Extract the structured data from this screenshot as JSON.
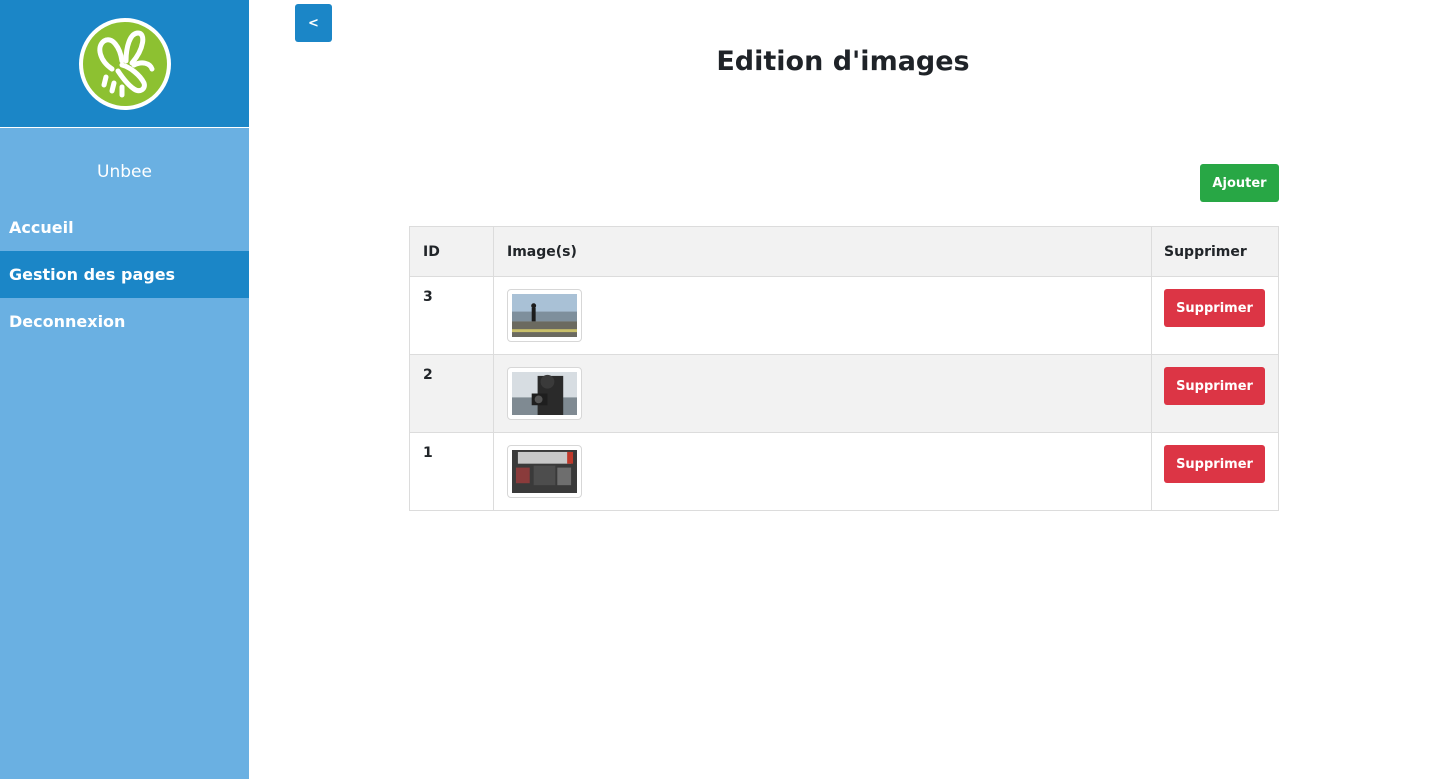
{
  "sidebar": {
    "logo_icon": "bee-logo-icon",
    "brand": "Unbee",
    "items": [
      {
        "label": "Accueil",
        "active": false
      },
      {
        "label": "Gestion des pages",
        "active": true
      },
      {
        "label": "Deconnexion",
        "active": false
      }
    ]
  },
  "header": {
    "toggle_label": "<",
    "title": "Edition d'images"
  },
  "toolbar": {
    "add_label": "Ajouter"
  },
  "table": {
    "columns": [
      "ID",
      "Image(s)",
      "Supprimer"
    ],
    "rows": [
      {
        "id": "3",
        "image": "runner-photo",
        "delete_label": "Supprimer"
      },
      {
        "id": "2",
        "image": "camera-photo",
        "delete_label": "Supprimer"
      },
      {
        "id": "1",
        "image": "office-photo",
        "delete_label": "Supprimer"
      }
    ]
  },
  "colors": {
    "sidebar_bg": "#6ab0e2",
    "sidebar_header": "#1b86c7",
    "active_item": "#1b86c7",
    "logo_green": "#8dc131",
    "add_button": "#28a745",
    "delete_button": "#dc3545"
  }
}
